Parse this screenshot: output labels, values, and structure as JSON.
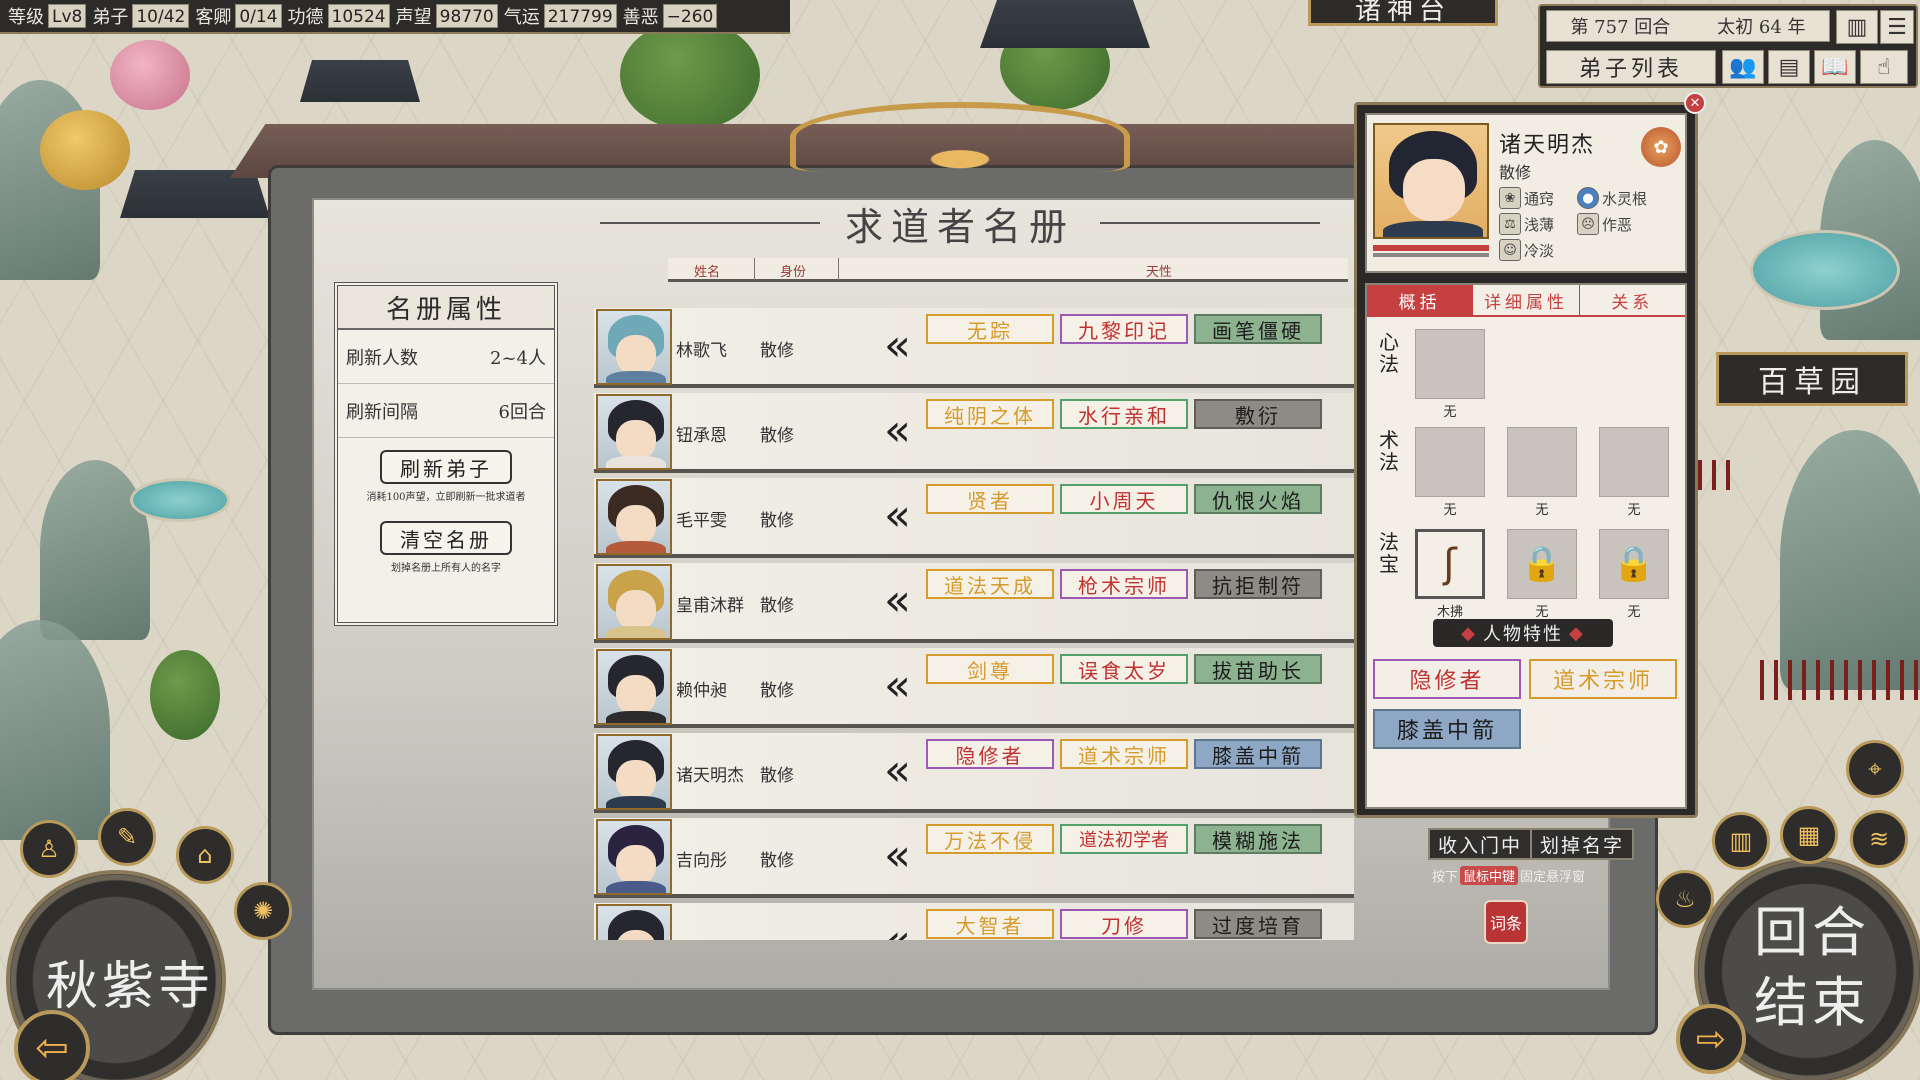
{
  "topbar": {
    "stats": [
      {
        "label": "等级",
        "value": "Lv8"
      },
      {
        "label": "弟子",
        "value": "10/42"
      },
      {
        "label": "客卿",
        "value": "0/14"
      },
      {
        "label": "功德",
        "value": "10524"
      },
      {
        "label": "声望",
        "value": "98770"
      },
      {
        "label": "气运",
        "value": "217799"
      },
      {
        "label": "善恶",
        "value": "−260"
      }
    ],
    "turn_text": "第 757 回合",
    "era_text": "太初 64 年",
    "disciple_list_label": "弟子列表",
    "top_sign": "诸神台"
  },
  "registry": {
    "title": "求道者名册",
    "col_name": "姓名",
    "col_identity": "身份",
    "col_nature": "天性",
    "props": {
      "title": "名册属性",
      "refresh_count_label": "刷新人数",
      "refresh_count_value": "2~4人",
      "refresh_interval_label": "刷新间隔",
      "refresh_interval_value": "6回合",
      "refresh_button": "刷新弟子",
      "refresh_note": "消耗100声望，立即刷新一批求道者",
      "clear_button": "清空名册",
      "clear_note": "划掉名册上所有人的名字"
    },
    "rows": [
      {
        "name": "林歌飞",
        "identity": "散修",
        "traits": [
          "无踪",
          "九黎印记",
          "画笔僵硬"
        ]
      },
      {
        "name": "钮承恩",
        "identity": "散修",
        "traits": [
          "纯阴之体",
          "水行亲和",
          "敷衍"
        ]
      },
      {
        "name": "毛平雯",
        "identity": "散修",
        "traits": [
          "贤者",
          "小周天",
          "仇恨火焰"
        ]
      },
      {
        "name": "皇甫沐群",
        "identity": "散修",
        "traits": [
          "道法天成",
          "枪术宗师",
          "抗拒制符"
        ]
      },
      {
        "name": "赖仲昶",
        "identity": "散修",
        "traits": [
          "剑尊",
          "误食太岁",
          "拔苗助长"
        ]
      },
      {
        "name": "诸天明杰",
        "identity": "散修",
        "traits": [
          "隐修者",
          "道术宗师",
          "膝盖中箭"
        ]
      },
      {
        "name": "吉向彤",
        "identity": "散修",
        "traits": [
          "万法不侵",
          "道法初学者",
          "模糊施法"
        ]
      },
      {
        "name": "",
        "identity": "",
        "traits": [
          "大智者",
          "刀修",
          "过度培育"
        ]
      }
    ],
    "recruit_button": "收入门中",
    "strike_button": "划掉名字",
    "hint_prefix": "按下",
    "hint_key": "鼠标中键",
    "hint_suffix": "固定悬浮窗",
    "entry_label": "词条"
  },
  "detail": {
    "name": "诸天明杰",
    "identity": "散修",
    "attrs": [
      "通窍",
      "水灵根",
      "浅薄",
      "作恶",
      "冷淡"
    ],
    "tabs": [
      "概括",
      "详细属性",
      "关系"
    ],
    "heart_method_label": "心法",
    "technique_label": "术法",
    "treasure_label": "法宝",
    "empty": "无",
    "treasure_item": "木拂",
    "traits_header": "人物特性",
    "traits": [
      "隐修者",
      "道术宗师",
      "膝盖中箭"
    ]
  },
  "map": {
    "building_sign": "百草园",
    "sect_name": "秋紫寺",
    "end_turn": "回合结束"
  },
  "colors": {
    "accent_red": "#c54040",
    "gold": "#d79a2c",
    "panel_dark": "#2a2927"
  }
}
